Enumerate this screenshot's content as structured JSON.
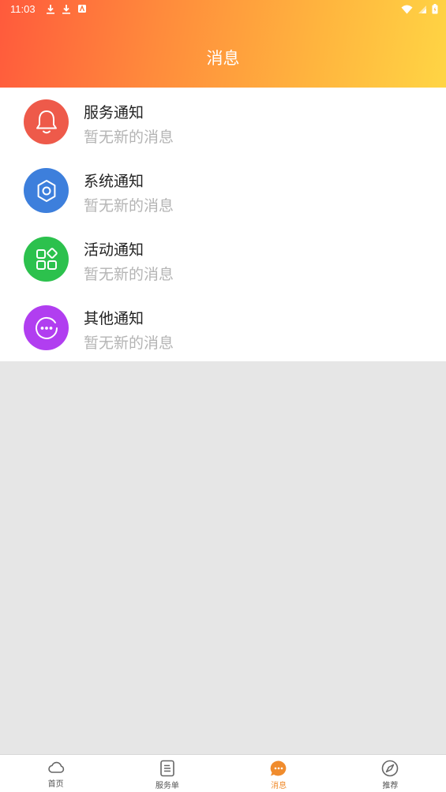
{
  "status_bar": {
    "time": "11:03",
    "left_icons": [
      "download-icon",
      "download-icon",
      "app-notification-icon"
    ],
    "right_icons": [
      "wifi-icon",
      "signal-icon",
      "battery-icon"
    ]
  },
  "header": {
    "title": "消息",
    "gradient": [
      "#ff5a3c",
      "#ffd544"
    ]
  },
  "notifications": [
    {
      "title": "服务通知",
      "subtitle": "暂无新的消息",
      "icon": "bell-icon",
      "color": "#ee5a4a"
    },
    {
      "title": "系统通知",
      "subtitle": "暂无新的消息",
      "icon": "gear-icon",
      "color": "#3d7fdc"
    },
    {
      "title": "活动通知",
      "subtitle": "暂无新的消息",
      "icon": "apps-icon",
      "color": "#2cc14d"
    },
    {
      "title": "其他通知",
      "subtitle": "暂无新的消息",
      "icon": "more-chat-icon",
      "color": "#b13ef0"
    }
  ],
  "tabbar": {
    "active": "消息",
    "accent": "#f08c2e",
    "tabs": [
      {
        "label": "首页",
        "icon": "cloud-icon"
      },
      {
        "label": "服务单",
        "icon": "document-icon"
      },
      {
        "label": "消息",
        "icon": "chat-bubble-icon"
      },
      {
        "label": "推荐",
        "icon": "compass-icon"
      }
    ]
  }
}
